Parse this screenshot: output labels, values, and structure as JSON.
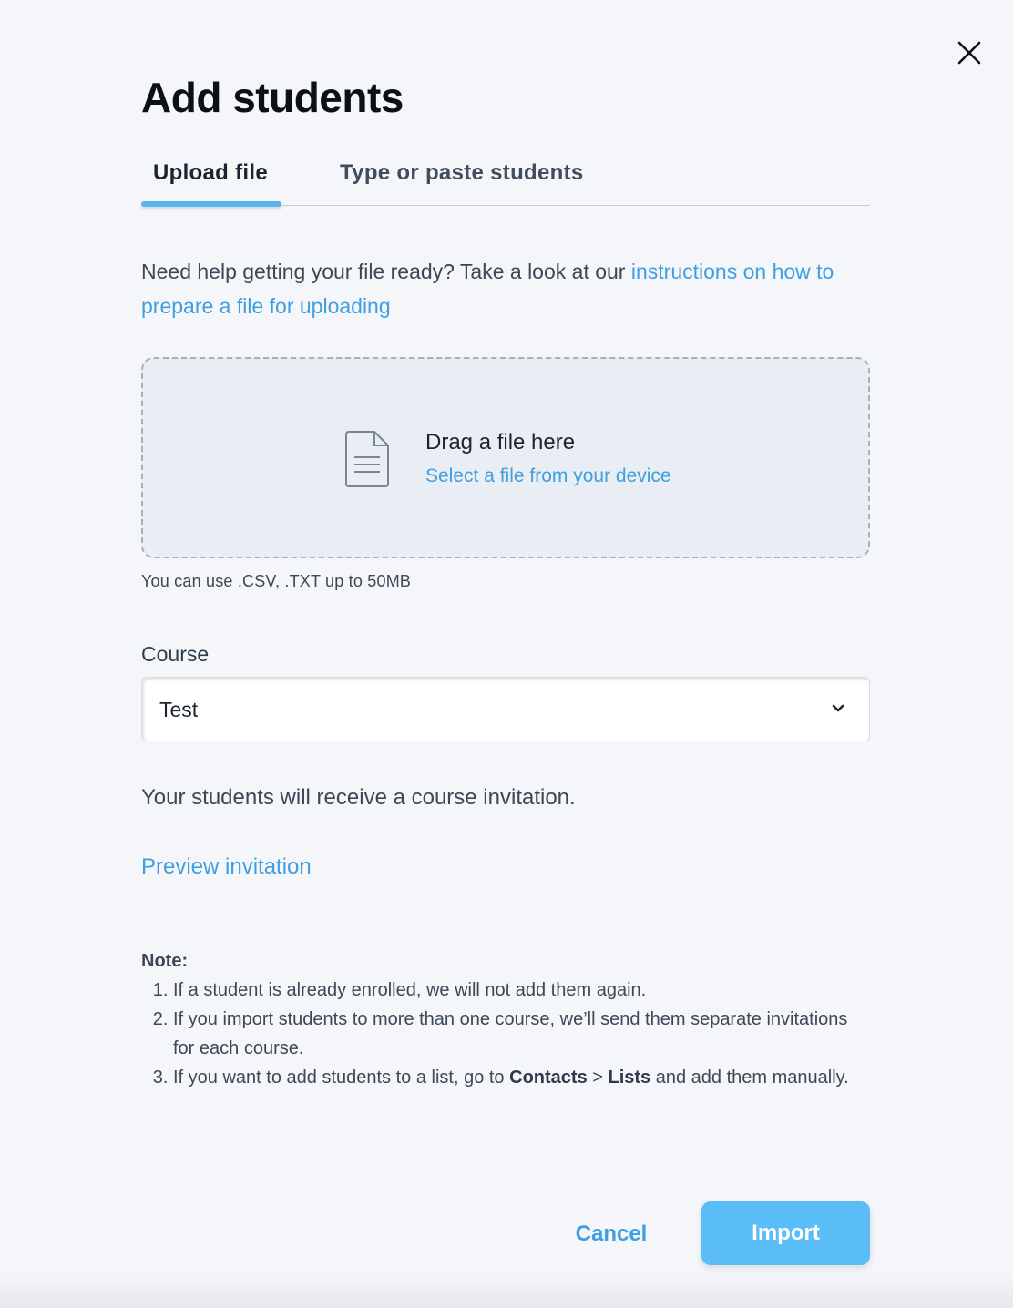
{
  "dialog": {
    "title": "Add students",
    "close_icon": "close-icon"
  },
  "tabs": [
    {
      "label": "Upload file",
      "active": true
    },
    {
      "label": "Type or paste students",
      "active": false
    }
  ],
  "help": {
    "text": "Need help getting your file ready? Take a look at our ",
    "link": "instructions on how to prepare a file for uploading"
  },
  "dropzone": {
    "icon": "document-icon",
    "title": "Drag a file here",
    "link": "Select a file from your device"
  },
  "file_hint": "You can use .CSV, .TXT up to 50MB",
  "course": {
    "label": "Course",
    "value": "Test",
    "icon": "chevron-down-icon"
  },
  "invitation": {
    "text": "Your students will receive a course invitation.",
    "preview_link": "Preview invitation"
  },
  "note": {
    "title": "Note:",
    "item1": "If a student is already enrolled, we will not add them again.",
    "item2": "If you import students to more than one course, we’ll send them separate invitations for each course.",
    "item3_prefix": "If you want to add students to a list, go to ",
    "item3_contacts": "Contacts",
    "item3_sep": " > ",
    "item3_lists": "Lists",
    "item3_suffix": " and add them manually."
  },
  "actions": {
    "cancel": "Cancel",
    "import": "Import"
  },
  "colors": {
    "accent": "#3f9fe0",
    "primary_button": "#5bbdf7",
    "tab_underline": "#5ab4ef"
  }
}
